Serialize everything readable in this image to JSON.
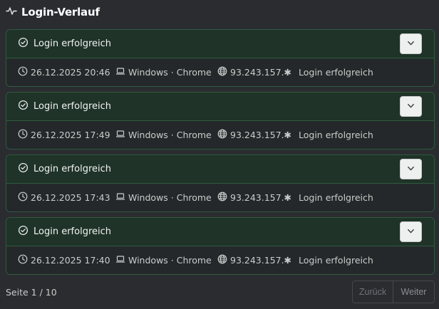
{
  "section": {
    "icon": "activity-icon",
    "title": "Login-Verlauf"
  },
  "entries": [
    {
      "status": "Login erfolgreich",
      "time": "26.12.2025 20:46",
      "device": "Windows · Chrome",
      "ip": "93.243.157.✱",
      "note": "Login erfolgreich"
    },
    {
      "status": "Login erfolgreich",
      "time": "26.12.2025 17:49",
      "device": "Windows · Chrome",
      "ip": "93.243.157.✱",
      "note": "Login erfolgreich"
    },
    {
      "status": "Login erfolgreich",
      "time": "26.12.2025 17:43",
      "device": "Windows · Chrome",
      "ip": "93.243.157.✱",
      "note": "Login erfolgreich"
    },
    {
      "status": "Login erfolgreich",
      "time": "26.12.2025 17:40",
      "device": "Windows · Chrome",
      "ip": "93.243.157.✱",
      "note": "Login erfolgreich"
    }
  ],
  "icons": {
    "status": "check-circle-icon",
    "toggle": "chevron-down-icon",
    "time": "clock-icon",
    "device": "laptop-icon",
    "ip": "globe-icon"
  },
  "pagination": {
    "info": "Seite 1 / 10",
    "prev_label": "Zurück",
    "next_label": "Weiter"
  },
  "colors": {
    "background": "#2a2c30",
    "card_header": "#1f3328",
    "card_border": "#2f5a3e",
    "text": "#e6e8e6"
  }
}
